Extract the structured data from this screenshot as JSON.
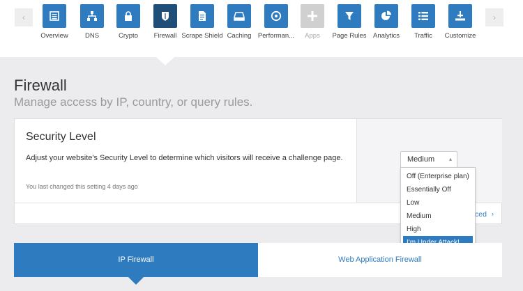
{
  "nav": {
    "items": [
      {
        "label": "Overview",
        "icon": "overview-icon",
        "state": "normal"
      },
      {
        "label": "DNS",
        "icon": "dns-icon",
        "state": "normal"
      },
      {
        "label": "Crypto",
        "icon": "lock-icon",
        "state": "normal"
      },
      {
        "label": "Firewall",
        "icon": "shield-icon",
        "state": "active"
      },
      {
        "label": "Scrape Shield",
        "icon": "document-icon",
        "state": "normal"
      },
      {
        "label": "Caching",
        "icon": "drive-icon",
        "state": "normal"
      },
      {
        "label": "Performan...",
        "icon": "gauge-icon",
        "state": "normal"
      },
      {
        "label": "Apps",
        "icon": "plus-icon",
        "state": "disabled"
      },
      {
        "label": "Page Rules",
        "icon": "filter-icon",
        "state": "normal"
      },
      {
        "label": "Analytics",
        "icon": "pie-chart-icon",
        "state": "normal"
      },
      {
        "label": "Traffic",
        "icon": "list-icon",
        "state": "normal"
      },
      {
        "label": "Customize",
        "icon": "tools-icon",
        "state": "normal"
      }
    ],
    "left_arrow": "‹",
    "right_arrow": "›"
  },
  "page": {
    "title": "Firewall",
    "subtitle": "Manage access by IP, country, or query rules."
  },
  "security_level": {
    "title": "Security Level",
    "description": "Adjust your website's Security Level to determine which visitors will receive a challenge page.",
    "last_changed": "You last changed this setting 4 days ago",
    "selected_value": "Medium",
    "options": [
      "Off (Enterprise plan)",
      "Essentially Off",
      "Low",
      "Medium",
      "High",
      "I'm Under Attack!"
    ],
    "highlighted_option": "I'm Under Attack!",
    "footer_link_partial": "ced",
    "footer_arrow": "›"
  },
  "tabs": [
    {
      "label": "IP Firewall",
      "active": true
    },
    {
      "label": "Web Application Firewall",
      "active": false
    }
  ],
  "colors": {
    "accent": "#2f7bbf",
    "active_nav": "#1f4e79",
    "disabled_nav": "#d0d0d0",
    "background": "#ececef"
  }
}
